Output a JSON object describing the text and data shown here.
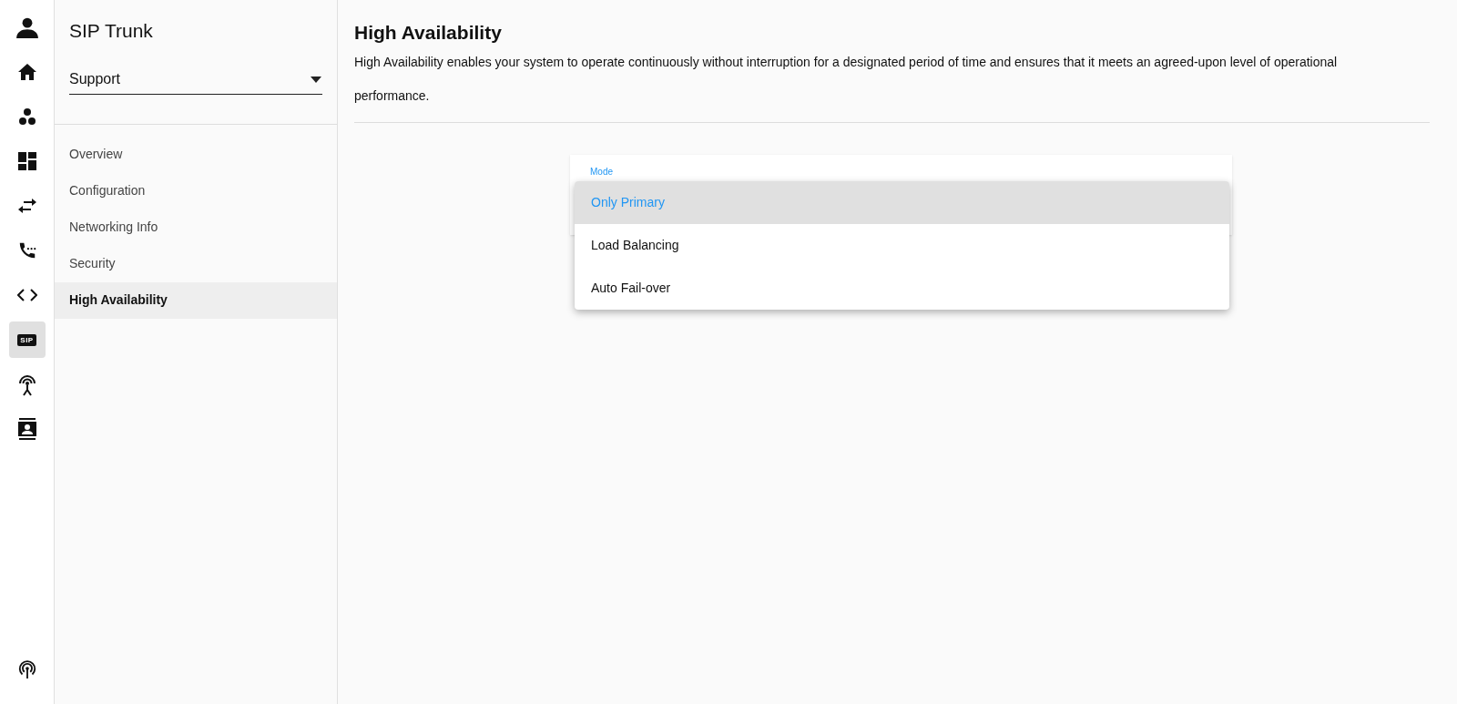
{
  "rail": {
    "items": [
      {
        "kind": "user",
        "selected": false
      },
      {
        "kind": "home",
        "selected": false
      },
      {
        "kind": "dots",
        "selected": false
      },
      {
        "kind": "dashboard",
        "selected": false
      },
      {
        "kind": "swap",
        "selected": false
      },
      {
        "kind": "phone",
        "selected": false
      },
      {
        "kind": "code",
        "selected": false
      },
      {
        "kind": "sip",
        "label": "SIP",
        "selected": true
      },
      {
        "kind": "antenna",
        "selected": false
      },
      {
        "kind": "contact",
        "selected": false
      }
    ],
    "bottom": {
      "kind": "podcast"
    }
  },
  "sidebar": {
    "title": "SIP Trunk",
    "select": {
      "value": "Support"
    },
    "items": [
      {
        "label": "Overview",
        "selected": false
      },
      {
        "label": "Configuration",
        "selected": false
      },
      {
        "label": "Networking Info",
        "selected": false
      },
      {
        "label": "Security",
        "selected": false
      },
      {
        "label": "High Availability",
        "selected": true
      }
    ]
  },
  "main": {
    "title": "High Availability",
    "description": "High Availability enables your system to operate continuously without interruption for a designated period of time and ensures that it meets an agreed-upon level of operational performance.",
    "field": {
      "label": "Mode"
    },
    "menu": [
      {
        "label": "Only Primary",
        "selected": true
      },
      {
        "label": "Load Balancing",
        "selected": false
      },
      {
        "label": "Auto Fail-over",
        "selected": false
      }
    ]
  }
}
